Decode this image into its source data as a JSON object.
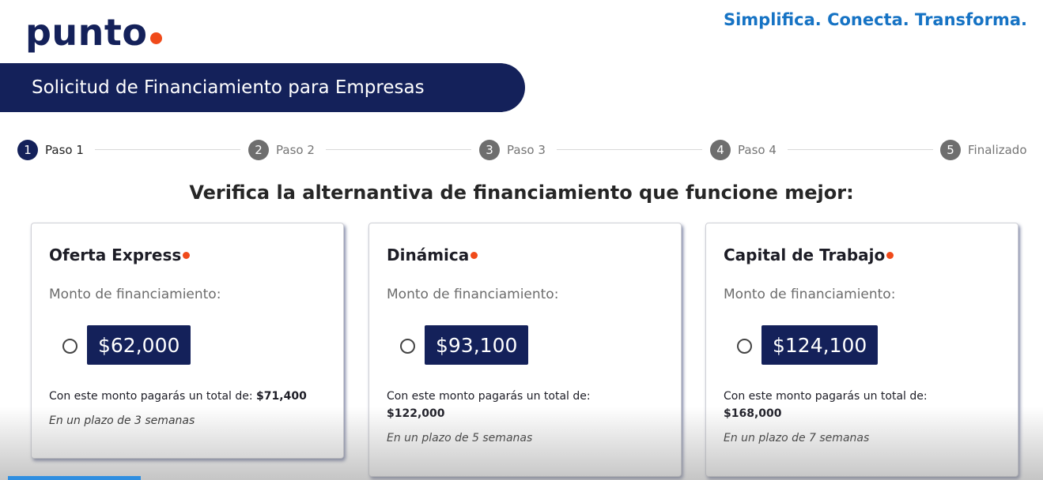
{
  "brand": {
    "logo_text": "punto",
    "dot_color": "#f04a1a",
    "primary_color": "#14215a",
    "accent_color": "#1673c4"
  },
  "header": {
    "slogan": "Simplifica. Conecta. Transforma."
  },
  "banner": {
    "title": "Solicitud de Financiamiento para Empresas"
  },
  "stepper": {
    "steps": [
      {
        "num": "1",
        "label": "Paso 1",
        "active": true
      },
      {
        "num": "2",
        "label": "Paso 2",
        "active": false
      },
      {
        "num": "3",
        "label": "Paso 3",
        "active": false
      },
      {
        "num": "4",
        "label": "Paso 4",
        "active": false
      },
      {
        "num": "5",
        "label": "Finalizado",
        "active": false
      }
    ]
  },
  "heading": "Verifica la alternantiva de financiamiento que funcione mejor:",
  "cards": [
    {
      "title": "Oferta Express",
      "amount_label": "Monto de financiamiento:",
      "amount": "$62,000",
      "total_prefix": "Con este monto pagarás un total de:",
      "total": "$71,400",
      "term": "En un plazo de 3 semanas"
    },
    {
      "title": "Dinámica",
      "amount_label": "Monto de financiamiento:",
      "amount": "$93,100",
      "total_prefix": "Con este monto pagarás un total de:",
      "total": "$122,000",
      "term": "En un plazo de 5 semanas"
    },
    {
      "title": "Capital de Trabajo",
      "amount_label": "Monto de financiamiento:",
      "amount": "$124,100",
      "total_prefix": "Con este monto pagarás un total de:",
      "total": "$168,000",
      "term": "En un plazo de 7 semanas"
    }
  ]
}
